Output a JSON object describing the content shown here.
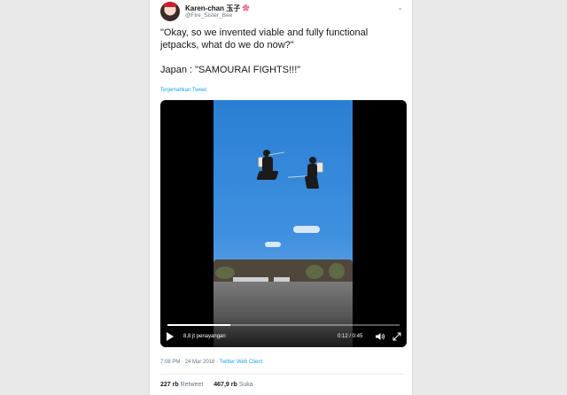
{
  "author": {
    "display_name": "Karen-chan 玉子",
    "badge": "✿",
    "handle": "@Fire_Sister_Bee"
  },
  "tweet": {
    "line1": "\"Okay, so we invented viable and fully functional jetpacks, what do we do now?\"",
    "line2": "Japan : \"SAMOURAI FIGHTS!!!\"",
    "translate_link": "Terjemahkan Tweet"
  },
  "video": {
    "views": "8,8 jt penayangan",
    "timecode": "0:12 / 0:45",
    "progress": 0.27,
    "icons": [
      "play-icon",
      "volume-icon",
      "fullscreen-icon"
    ]
  },
  "meta": {
    "time": "7:08 PM",
    "separator": "·",
    "date": "24 Mar 2018",
    "client": "Twitter Web Client"
  },
  "stats": {
    "retweets_count": "227 rb",
    "retweets_label": "Retweet",
    "likes_count": "467,9 rb",
    "likes_label": "Suka"
  },
  "colors": {
    "link": "#1da1f2",
    "text": "#14171a",
    "muted": "#657786",
    "background": "#e9e9e9"
  }
}
